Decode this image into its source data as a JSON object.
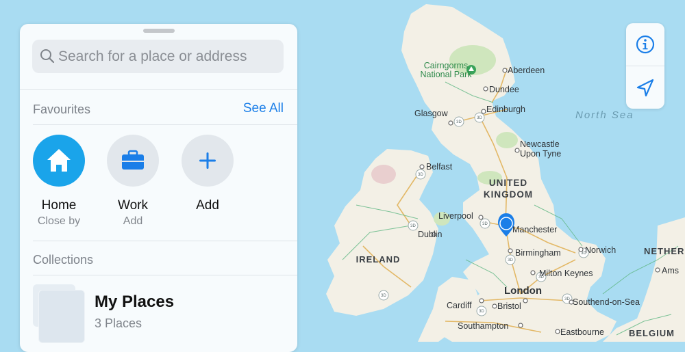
{
  "search": {
    "placeholder": "Search for a place or address"
  },
  "favourites": {
    "title": "Favourites",
    "see_all": "See All",
    "items": [
      {
        "name": "Home",
        "subtitle": "Close by",
        "icon": "house-icon"
      },
      {
        "name": "Work",
        "subtitle": "Add",
        "icon": "briefcase-icon"
      },
      {
        "name": "Add",
        "subtitle": "",
        "icon": "plus-icon"
      }
    ]
  },
  "collections": {
    "title": "Collections",
    "items": [
      {
        "name": "My Places",
        "count": "3 Places"
      }
    ]
  },
  "map": {
    "labels": {
      "cairngorms_1": "Cairngorms",
      "cairngorms_2": "National Park",
      "aberdeen": "Aberdeen",
      "dundee": "Dundee",
      "glasgow": "Glasgow",
      "edinburgh": "Edinburgh",
      "north_sea": "North Sea",
      "newcastle_1": "Newcastle",
      "newcastle_2": "Upon Tyne",
      "belfast": "Belfast",
      "uk_1": "UNITED",
      "uk_2": "KINGDOM",
      "liverpool": "Liverpool",
      "manchester": "Manchester",
      "dublin": "Dublin",
      "ireland": "IRELAND",
      "norwich": "Norwich",
      "birmingham": "Birmingham",
      "netherlands": "NETHER",
      "amsterdam": "Ams",
      "milton_keynes": "Milton Keynes",
      "london": "London",
      "cardiff": "Cardiff",
      "bristol": "Bristol",
      "southend": "Southend-on-Sea",
      "southampton": "Southampton",
      "eastbourne": "Eastbourne",
      "belgium": "BELGIUM"
    },
    "road_badge": "3D"
  },
  "colors": {
    "water": "#a9dcf2",
    "land": "#f3f0e6",
    "park": "#cfe6bd",
    "accent": "#1a7ee8",
    "home_circle": "#1aa4ea"
  }
}
